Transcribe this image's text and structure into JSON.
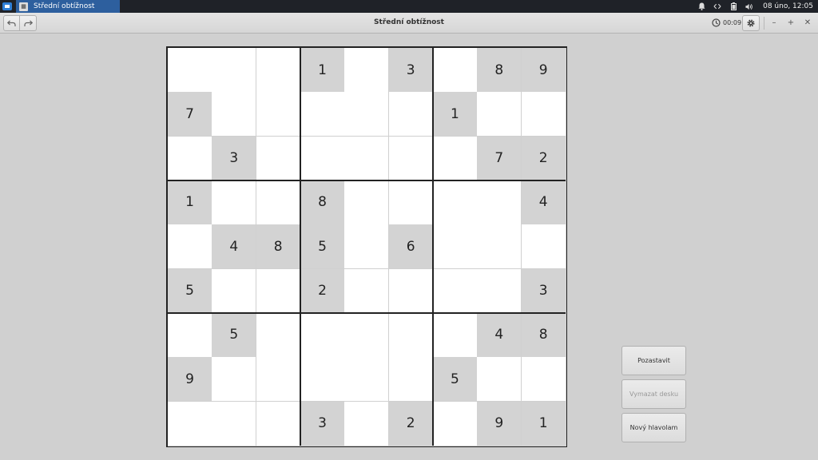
{
  "taskbar": {
    "window_title": "Střední obtížnost",
    "clock": "08 úno, 12:05"
  },
  "header": {
    "title": "Střední obtížnost",
    "timer": "00:09"
  },
  "board": {
    "grid": [
      [
        "",
        "",
        "",
        "1",
        "",
        "3",
        "",
        "8",
        "9"
      ],
      [
        "7",
        "",
        "",
        "",
        "",
        "",
        "1",
        "",
        ""
      ],
      [
        "",
        "3",
        "",
        "",
        "",
        "",
        "",
        "7",
        "2"
      ],
      [
        "1",
        "",
        "",
        "8",
        "",
        "",
        "",
        "",
        "4"
      ],
      [
        "",
        "4",
        "8",
        "5",
        "",
        "6",
        "",
        "",
        ""
      ],
      [
        "5",
        "",
        "",
        "2",
        "",
        "",
        "",
        "",
        "3"
      ],
      [
        "",
        "5",
        "",
        "",
        "",
        "",
        "",
        "4",
        "8"
      ],
      [
        "9",
        "",
        "",
        "",
        "",
        "",
        "5",
        "",
        ""
      ],
      [
        "",
        "",
        "",
        "3",
        "",
        "2",
        "",
        "9",
        "1"
      ]
    ]
  },
  "buttons": {
    "pause": "Pozastavit",
    "clear": "Vymazat desku",
    "new": "Nový hlavolam"
  },
  "colors": {
    "given_cell": "#d3d3d3",
    "empty_cell": "#ffffff",
    "taskbar_active": "#2d5f9e"
  }
}
